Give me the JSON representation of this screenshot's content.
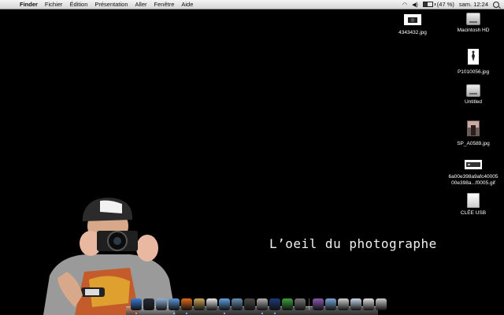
{
  "menubar": {
    "apple": "",
    "app": "Finder",
    "menus": [
      "Fichier",
      "Édition",
      "Présentation",
      "Aller",
      "Fenêtre",
      "Aide"
    ],
    "battery": "(47 %)",
    "battery_level": 0.47,
    "clock": "sam. 12:24"
  },
  "desktop": {
    "title": "L’oeil du photographe",
    "icons": [
      {
        "label": "4343432.jpg",
        "icon": "camera-image-icon"
      },
      {
        "label": "Macintosh HD",
        "icon": "hard-drive-icon"
      },
      {
        "label": "P1010056.jpg",
        "icon": "photo-icon"
      },
      {
        "label": "Untitled",
        "icon": "hard-drive-icon"
      },
      {
        "label": "SP_A0589.jpg",
        "icon": "photo-icon"
      },
      {
        "label": "6a00e398a9afc40005\n00e398a...f0005.gif",
        "icon": "image-icon"
      },
      {
        "label": "CLÉE USB",
        "icon": "usb-drive-icon"
      }
    ]
  },
  "dock": {
    "items": [
      {
        "name": "finder",
        "color": "#3b7bd6",
        "running": true
      },
      {
        "name": "dashboard",
        "color": "#2a2a3a",
        "running": false
      },
      {
        "name": "mail",
        "color": "#8fb0d8",
        "running": false
      },
      {
        "name": "safari",
        "color": "#5b97d8",
        "running": true
      },
      {
        "name": "firefox",
        "color": "#e06a1a",
        "running": true
      },
      {
        "name": "address-book",
        "color": "#c9a35a",
        "running": false
      },
      {
        "name": "ical",
        "color": "#e8e8e8",
        "running": false
      },
      {
        "name": "itunes",
        "color": "#5ea0e0",
        "running": true
      },
      {
        "name": "iphoto",
        "color": "#6a8fb0",
        "running": false
      },
      {
        "name": "spaces",
        "color": "#4a4a4a",
        "running": false
      },
      {
        "name": "preview",
        "color": "#b0b0b0",
        "running": true
      },
      {
        "name": "photoshop",
        "color": "#1d3a7a",
        "running": true
      },
      {
        "name": "msn",
        "color": "#3da03d",
        "running": false
      },
      {
        "name": "system-preferences",
        "color": "#777",
        "running": false
      }
    ],
    "stacks": [
      {
        "name": "dvd",
        "color": "#8a5ab0"
      },
      {
        "name": "applications-folder",
        "color": "#7aa7d8"
      },
      {
        "name": "documents",
        "color": "#d0d0d0"
      },
      {
        "name": "downloads",
        "color": "#c8d8e8"
      },
      {
        "name": "window-stack",
        "color": "#e0e0e0"
      },
      {
        "name": "trash",
        "color": "#cccccc"
      }
    ]
  }
}
